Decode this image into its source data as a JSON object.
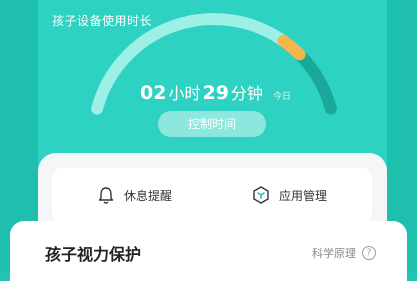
{
  "header": {
    "title": "孩子设备使用时长"
  },
  "usage": {
    "hours": "02",
    "hours_unit": "小时",
    "minutes": "29",
    "minutes_unit": "分钟",
    "period": "今日",
    "progress_fraction": 0.8,
    "colors": {
      "track": "#1aa89a",
      "fill": "#9df0e6",
      "accent": "#f3b64a"
    }
  },
  "control_button": {
    "label": "控制时间"
  },
  "menu": {
    "items": [
      {
        "label": "休息提醒",
        "icon": "bell-icon"
      },
      {
        "label": "应用管理",
        "icon": "app-cube-icon"
      }
    ]
  },
  "vision": {
    "title": "孩子视力保护",
    "link": "科学原理",
    "help_glyph": "?"
  }
}
